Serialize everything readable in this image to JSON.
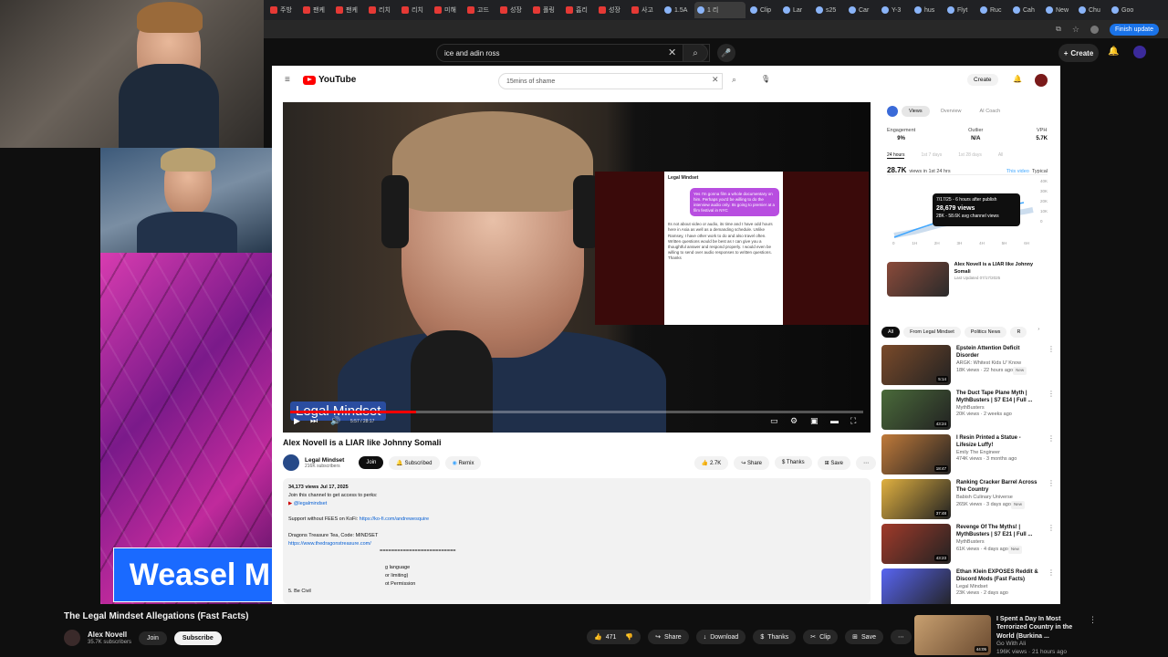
{
  "browser": {
    "tabs": [
      {
        "label": "주방"
      },
      {
        "label": "팬케"
      },
      {
        "label": "팬케"
      },
      {
        "label": "리치"
      },
      {
        "label": "리치"
      },
      {
        "label": "미해"
      },
      {
        "label": "고드"
      },
      {
        "label": "성장"
      },
      {
        "label": "폴링"
      },
      {
        "label": "흡리"
      },
      {
        "label": "성장"
      },
      {
        "label": "사고"
      },
      {
        "label": "1.5A"
      },
      {
        "label": "1 리",
        "active": true
      },
      {
        "label": "Clip"
      },
      {
        "label": "Lar"
      },
      {
        "label": "s25"
      },
      {
        "label": "Car"
      },
      {
        "label": "Y-3"
      },
      {
        "label": "hus"
      },
      {
        "label": "Flyt"
      },
      {
        "label": "Ruc"
      },
      {
        "label": "Cah"
      },
      {
        "label": "New"
      },
      {
        "label": "Chu"
      },
      {
        "label": "Goo"
      }
    ],
    "finish_update": "Finish update"
  },
  "outer_youtube": {
    "search_value": "ice and adin ross",
    "create_label": "Create"
  },
  "overlay": {
    "banner_text": "Weasel Mindset"
  },
  "inner_youtube": {
    "logo_text": "YouTube",
    "search_value": "15mins of shame",
    "create_label": "Create",
    "video": {
      "watermark": "Legal Mindset",
      "time": "5:57 / 28:17",
      "chat_header": "Legal Mindset",
      "chat_bubble": "Yes I'm gonna film a whole documentary on him. Perhaps you'd be willing to do the interview audio only. Its going to premier at a film festival in NYC",
      "chat_reply": "Its not about video or audio, its time and I have odd hours here in Asia as well as a demanding schedule. Unlike Ramsey, I have other work to do and also travel often. Written questions would be best as I can give you a thoughtful answer and respond properly. I would even be willing to send over audio responses to written questions. Thanks"
    },
    "title": "Alex Novell is a LIAR like Johnny Somali",
    "channel": {
      "name": "Legal Mindset",
      "subs": "216K subscribers",
      "join": "Join",
      "subscribed": "Subscribed",
      "remix": "Remix"
    },
    "actions": {
      "likes": "2.7K",
      "share": "Share",
      "thanks": "Thanks",
      "save": "Save"
    },
    "description": {
      "meta": "34,173 views  Jul 17, 2025",
      "line1": "Join this channel to get access to perks:",
      "line2": "@legalmindset",
      "line3": "Support without FEES on KoFi:",
      "link3": "https://ko-fi.com/andrewesquire",
      "line4": "Dragons Treasure Tea, Code: MINDSET",
      "link4": "https://www.thedragonstreasure.com/",
      "line5": "==========================",
      "line6": "g language",
      "line7": "or limiting)",
      "line8": "ot Permission",
      "line9": "5. Be Civil"
    },
    "analytics": {
      "tabs": [
        "Views",
        "Overview",
        "AI Coach"
      ],
      "stats": [
        {
          "label": "Engagement",
          "value": "9%"
        },
        {
          "label": "Outlier",
          "value": "N/A"
        },
        {
          "label": "VPH",
          "value": "5.7K"
        }
      ],
      "range_tabs": [
        "24 hours",
        "1st 7 days",
        "1st 28 days",
        "All"
      ],
      "headline": "28.7K",
      "headline_sub": "views in 1st 24 hrs",
      "this_video": "This video",
      "typical": "Typical",
      "tooltip_line1": "7/17/25 - 6 hours after publish",
      "tooltip_views": "28,679 views",
      "tooltip_line2": "28K - 58.6K avg channel views",
      "y_ticks": [
        "40K",
        "30K",
        "20K",
        "10K",
        "0"
      ],
      "x_ticks": [
        "0",
        "1H",
        "2H",
        "3H",
        "4H",
        "5H",
        "6H"
      ],
      "card_title": "Alex Novell is a LIAR like Johnny Somali",
      "card_sub": "Last Updated 07/17/2025"
    },
    "chips": [
      "All",
      "From Legal Mindset",
      "Politics News",
      "R"
    ],
    "recommendations": [
      {
        "title": "Epstein Attention Deficit Disorder",
        "channel": "ARGK: Whitest Kids U' Know",
        "meta": "18K views · 22 hours ago",
        "badge": "New",
        "duration": "5:14",
        "color": "#7a4a2a"
      },
      {
        "title": "The Duct Tape Plane Myth | MythBusters | S7 E14 | Full ...",
        "channel": "MythBusters",
        "meta": "20K views · 2 weeks ago",
        "badge": "",
        "duration": "43:24",
        "color": "#4a6a3a"
      },
      {
        "title": "I Resin Printed a Statue - Lifesize Luffy!",
        "channel": "Emily The Engineer",
        "meta": "474K views · 3 months ago",
        "badge": "",
        "duration": "18:47",
        "color": "#c07a3a"
      },
      {
        "title": "Ranking Cracker Barrel Across The Country",
        "channel": "Babish Culinary Universe",
        "meta": "265K views · 3 days ago",
        "badge": "New",
        "duration": "37:48",
        "color": "#e0b040"
      },
      {
        "title": "Revenge Of The Myths! | MythBusters | S7 E21 | Full ...",
        "channel": "MythBusters",
        "meta": "61K views · 4 days ago",
        "badge": "New",
        "duration": "43:23",
        "color": "#a03a2a"
      },
      {
        "title": "Ethan Klein EXPOSES Reddit & Discord Mods (Fast Facts)",
        "channel": "Legal Mindset",
        "meta": "23K views · 2 days ago",
        "badge": "",
        "duration": "",
        "color": "#5865f2"
      }
    ]
  },
  "bottom_bar": {
    "title": "The Legal Mindset Allegations (Fast Facts)",
    "channel": "Alex Novell",
    "subs": "35.7K subscribers",
    "join": "Join",
    "subscribe": "Subscribe",
    "likes": "471",
    "share": "Share",
    "download": "Download",
    "thanks": "Thanks",
    "clip": "Clip",
    "save": "Save",
    "rec": {
      "title": "I Spent a Day In Most Terrorized Country in the World (Burkina ...",
      "channel": "Go With Ali",
      "meta": "196K views · 21 hours ago",
      "duration": "44:05"
    }
  }
}
